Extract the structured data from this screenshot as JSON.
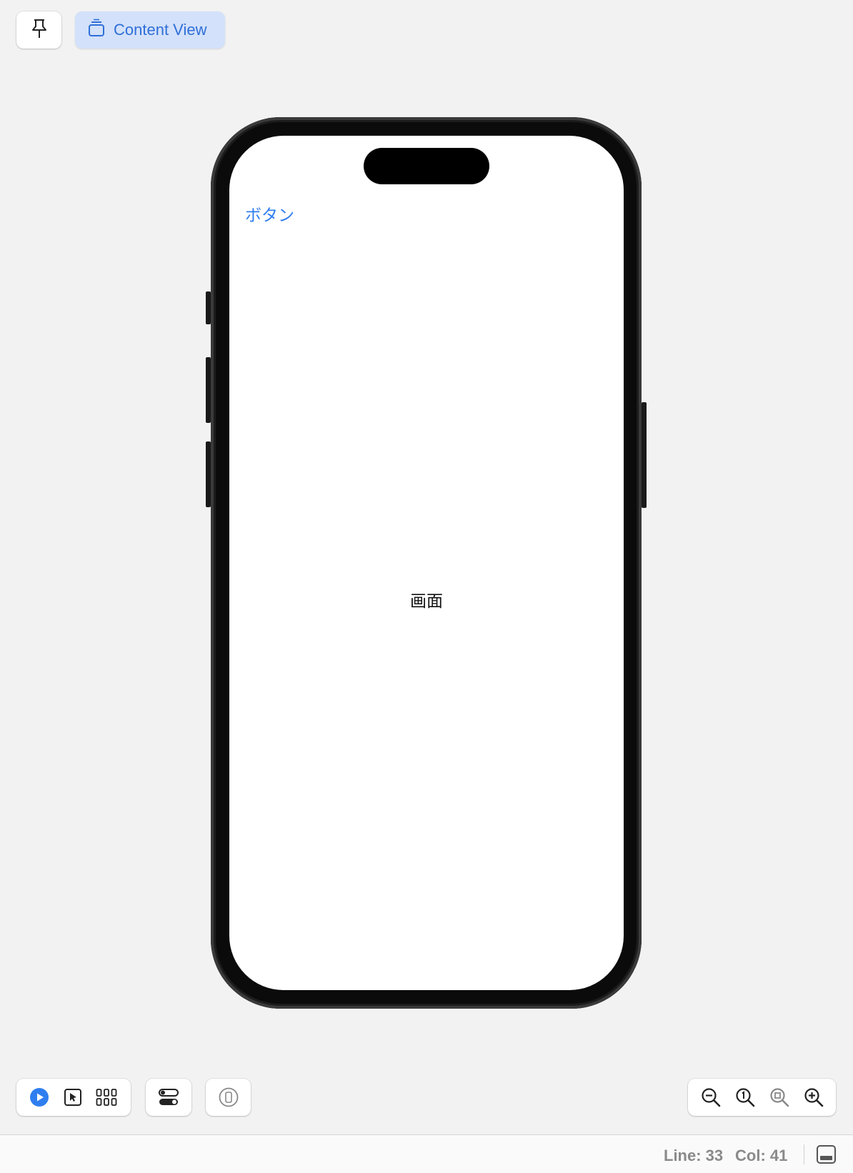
{
  "top_toolbar": {
    "pin_icon": "pin-icon",
    "content_view_label": "Content View",
    "content_view_icon": "stack-icon"
  },
  "preview": {
    "device": "iPhone",
    "app_button_label": "ボタン",
    "screen_text": "画面"
  },
  "bottom_toolbar": {
    "icons": [
      "live-preview-icon",
      "selectable-icon",
      "variants-grid-icon",
      "device-settings-icon",
      "device-icon"
    ],
    "zoom_icons": [
      "zoom-out-icon",
      "zoom-100-icon",
      "zoom-to-fit-icon",
      "zoom-in-icon"
    ],
    "accent": "#2f6fd8"
  },
  "status_bar": {
    "line": "Line: 33",
    "col": "Col: 41"
  }
}
